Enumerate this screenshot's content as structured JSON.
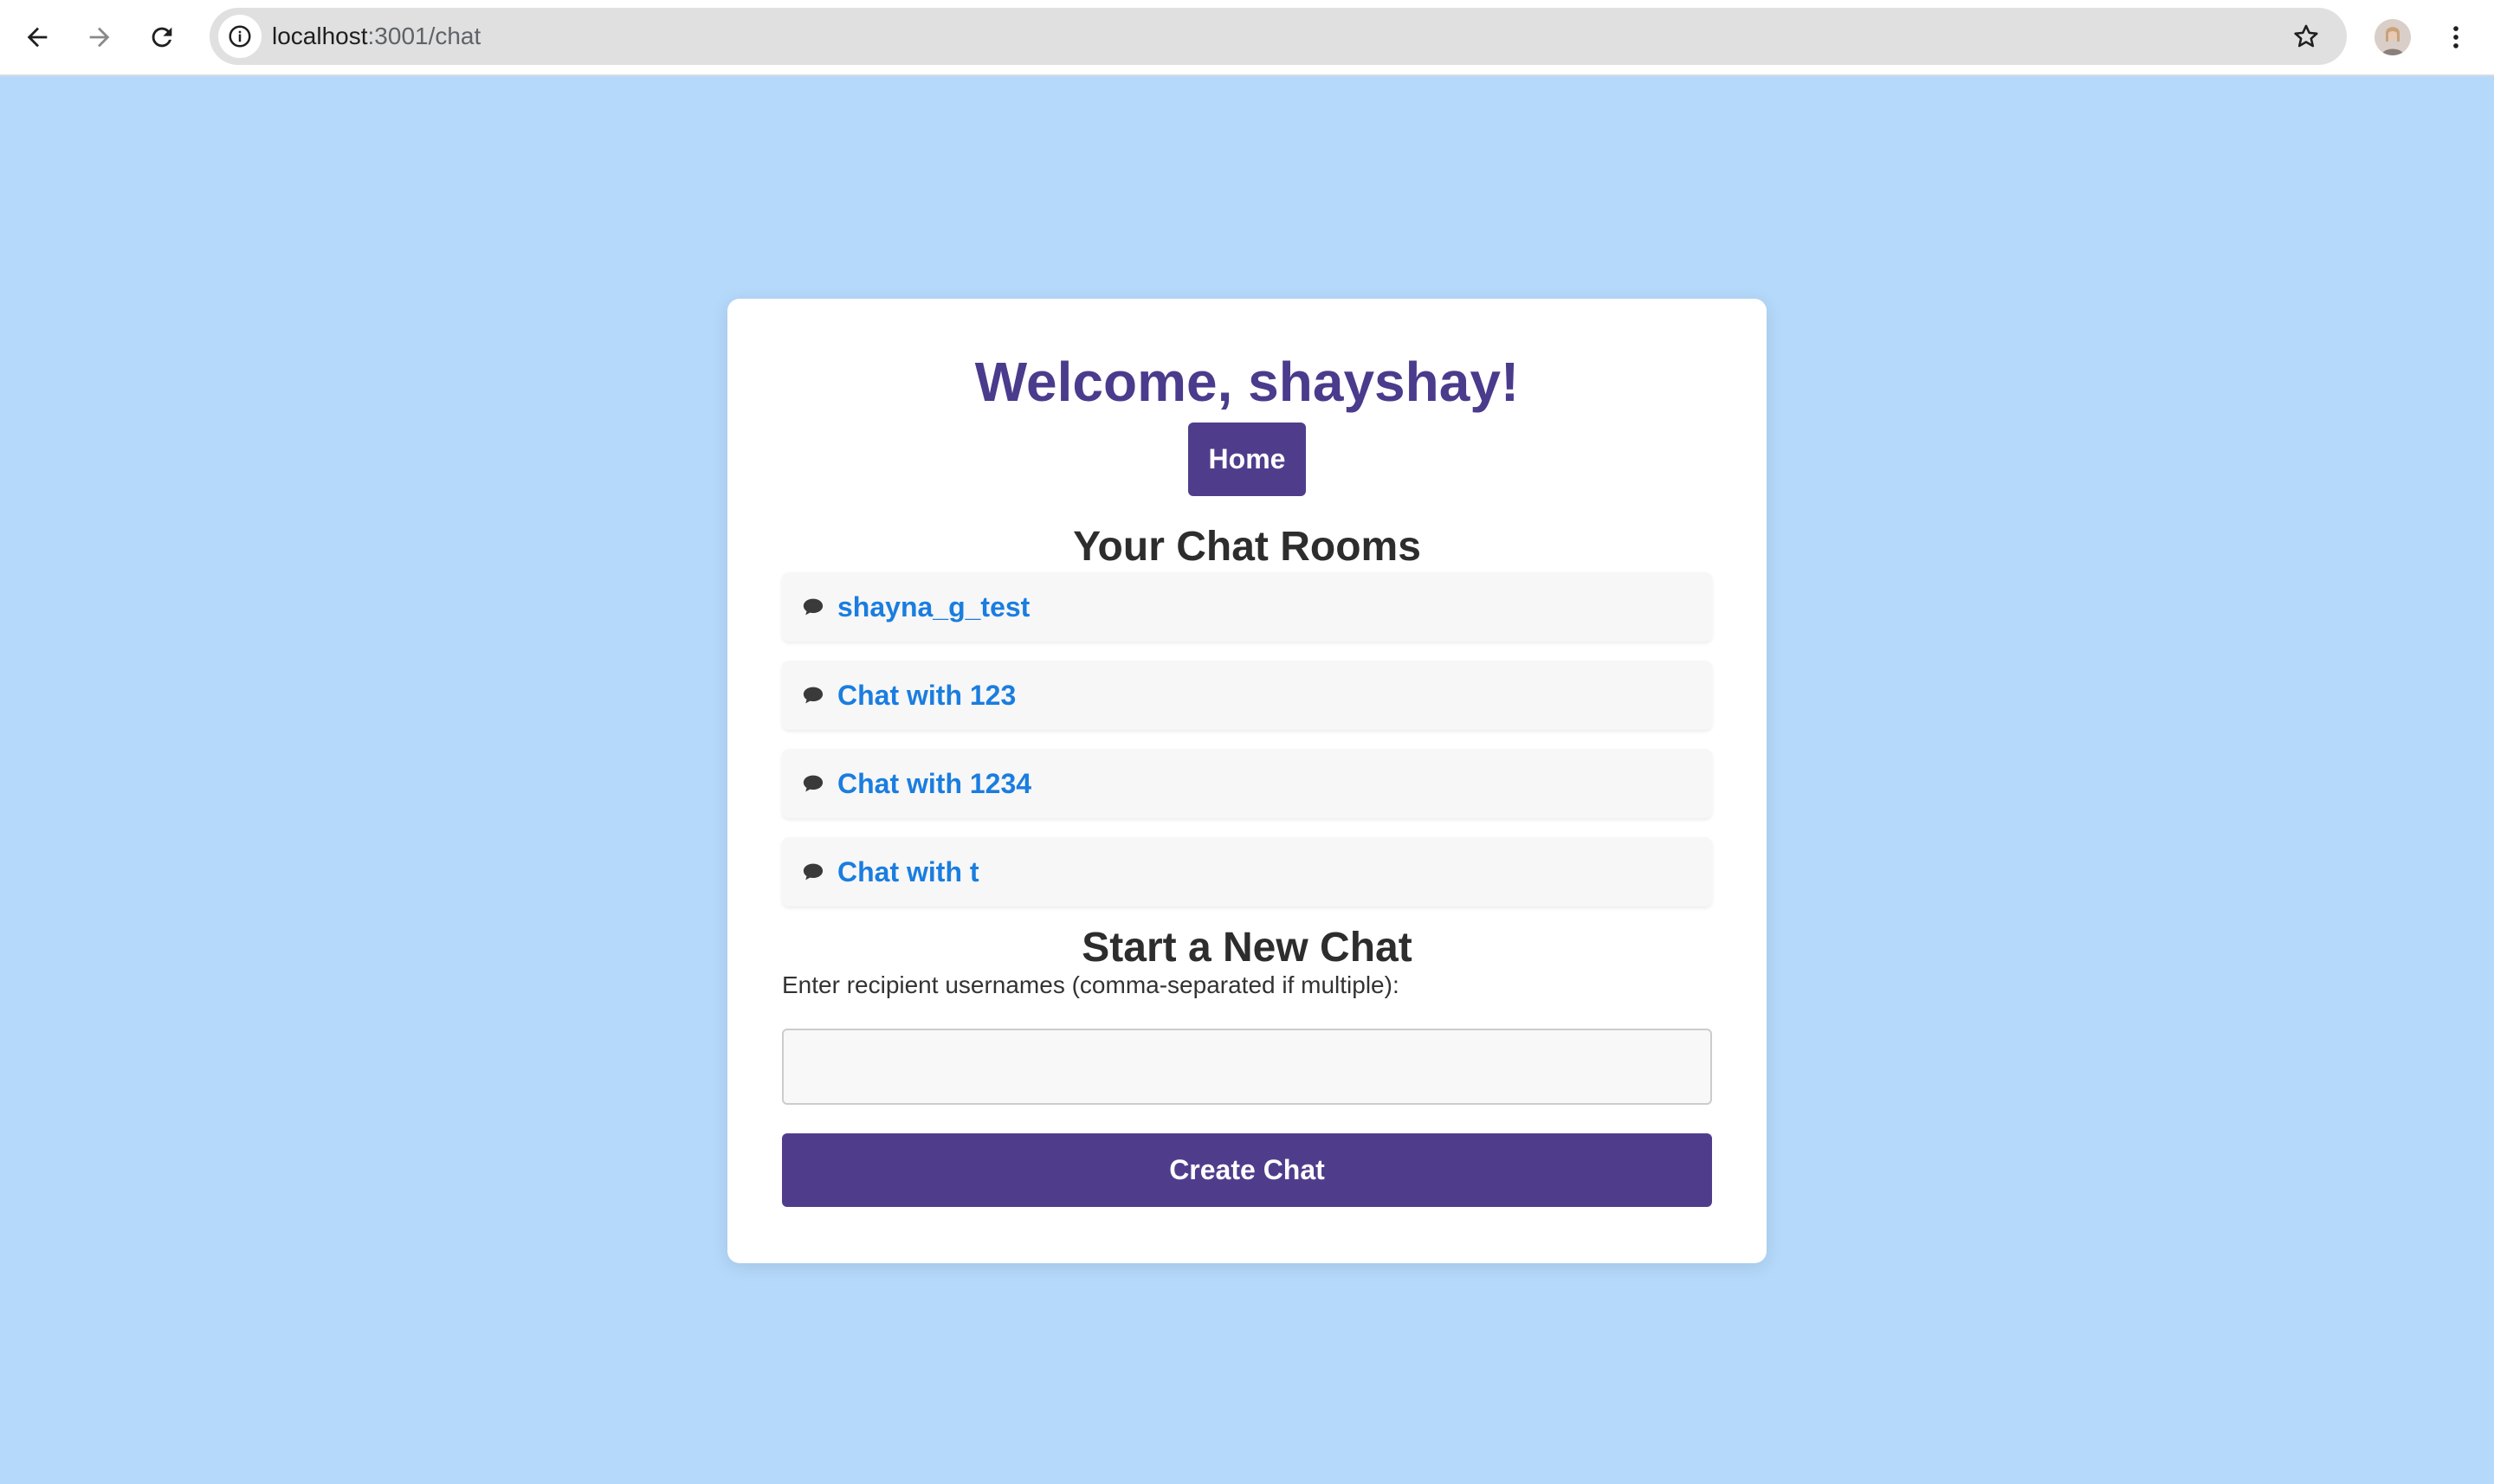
{
  "browser": {
    "url_host": "localhost",
    "url_path": ":3001/chat"
  },
  "page": {
    "welcome": "Welcome, shayshay!",
    "home_label": "Home",
    "rooms_title": "Your Chat Rooms",
    "rooms": [
      {
        "icon": "speech-bubble-icon",
        "label": "shayna_g_test"
      },
      {
        "icon": "speech-bubble-icon",
        "label": "Chat with 123"
      },
      {
        "icon": "speech-bubble-icon",
        "label": "Chat with 1234"
      },
      {
        "icon": "speech-bubble-icon",
        "label": "Chat with t"
      }
    ],
    "new_chat_title": "Start a New Chat",
    "recipient_prompt": "Enter recipient usernames (comma-separated if multiple):",
    "recipient_value": "",
    "create_label": "Create Chat"
  },
  "colors": {
    "background": "#b5d9fb",
    "accent": "#4f3d8c",
    "link": "#1a7de0"
  }
}
